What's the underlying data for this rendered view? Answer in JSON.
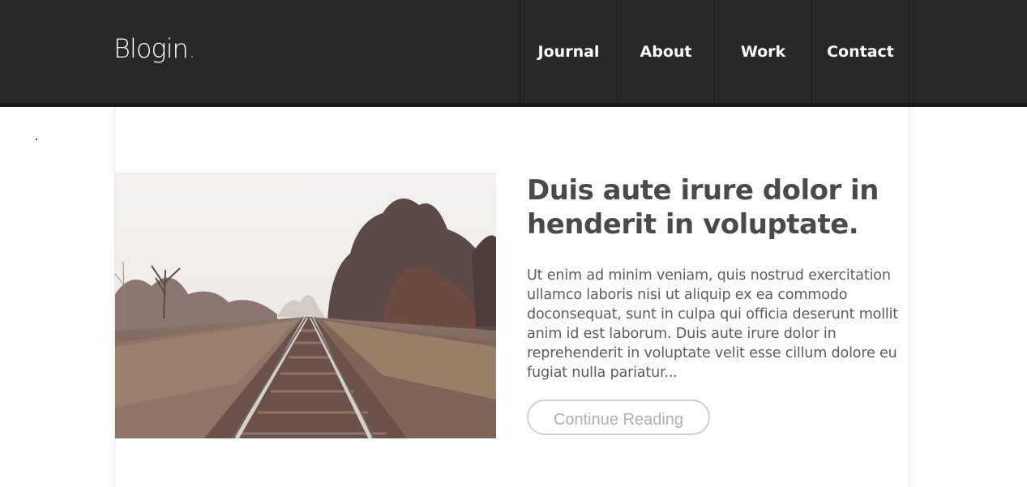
{
  "header": {
    "logo_text": "Blogin",
    "logo_dot": ".",
    "nav": [
      {
        "label": "Journal"
      },
      {
        "label": "About"
      },
      {
        "label": "Work"
      },
      {
        "label": "Contact"
      }
    ]
  },
  "post": {
    "image_icon": "railway-track-photo",
    "title": "Duis aute irure dolor in henderit in voluptate.",
    "excerpt": "Ut enim ad minim veniam, quis nostrud exercitation ullamco laboris nisi ut aliquip ex ea commodo doconsequat, sunt in culpa qui officia deserunt mollit anim id est laborum. Duis aute irure dolor in reprehenderit in voluptate velit esse cillum dolore eu fugiat nulla pariatur...",
    "button_label": "Continue Reading"
  },
  "colors": {
    "header_bg": "#282828",
    "accent": "#5fbf3a",
    "title": "#4a4a4a",
    "text": "#5c5c5c"
  }
}
